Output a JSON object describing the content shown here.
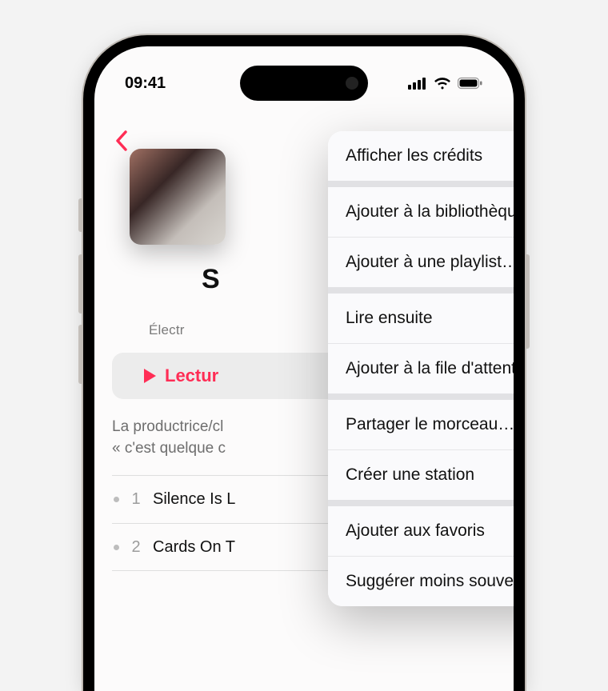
{
  "status": {
    "time": "09:41"
  },
  "accent": "#ff2d55",
  "album": {
    "title_partial": "S",
    "genre_partial": "Électr",
    "play_label_partial": "Lectur",
    "description_line1": "La productrice/cl",
    "description_line2": "« c'est quelque c"
  },
  "tracks": [
    {
      "num": "1",
      "title_partial": "Silence Is L"
    },
    {
      "num": "2",
      "title_partial": "Cards On T"
    }
  ],
  "menu": {
    "credits": "Afficher les crédits",
    "add_library": "Ajouter à la bibliothèque",
    "add_playlist": "Ajouter à une playlist…",
    "play_next": "Lire ensuite",
    "add_queue": "Ajouter à la file d'attente",
    "share": "Partager le morceau…",
    "create_station": "Créer une station",
    "favorite": "Ajouter aux favoris",
    "suggest_less": "Suggérer moins souvent"
  }
}
